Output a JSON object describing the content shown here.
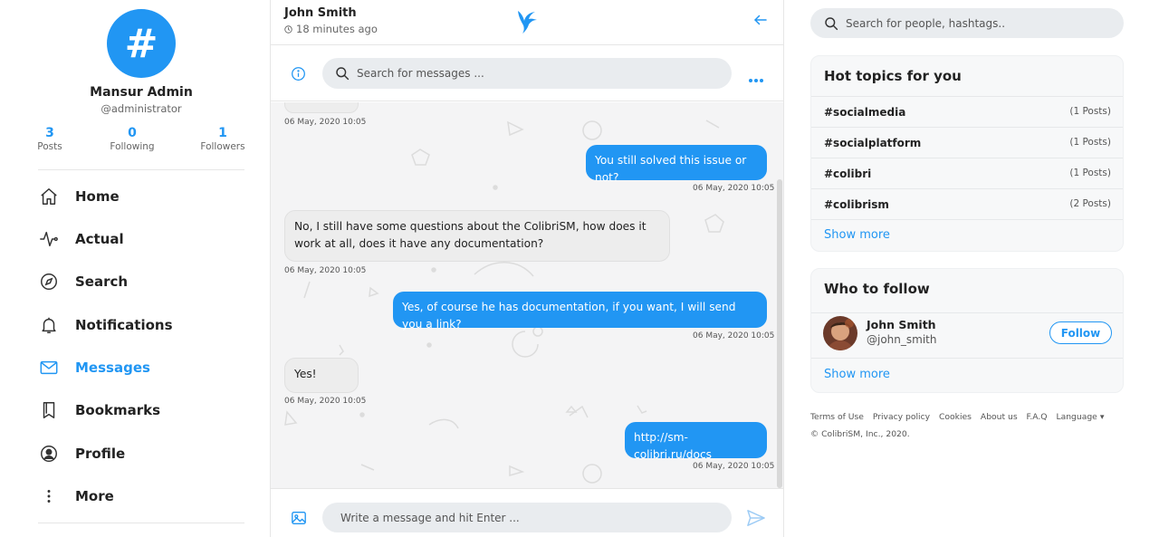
{
  "profile": {
    "avatar_glyph": "#",
    "name": "Mansur Admin",
    "handle": "@administrator",
    "stats": [
      {
        "value": "3",
        "label": "Posts"
      },
      {
        "value": "0",
        "label": "Following"
      },
      {
        "value": "1",
        "label": "Followers"
      }
    ]
  },
  "nav": [
    {
      "label": "Home",
      "icon": "home-icon",
      "active": false
    },
    {
      "label": "Actual",
      "icon": "pulse-icon",
      "active": false
    },
    {
      "label": "Search",
      "icon": "compass-icon",
      "active": false
    },
    {
      "label": "Notifications",
      "icon": "bell-icon",
      "active": false
    },
    {
      "label": "Messages",
      "icon": "mail-icon",
      "active": true
    },
    {
      "label": "Bookmarks",
      "icon": "bookmark-icon",
      "active": false
    },
    {
      "label": "Profile",
      "icon": "user-circle-icon",
      "active": false
    },
    {
      "label": "More",
      "icon": "more-vertical-icon",
      "active": false
    }
  ],
  "chat": {
    "contact_name": "John Smith",
    "last_seen": "18 minutes ago",
    "search_placeholder": "Search for messages ...",
    "compose_placeholder": "Write a message and hit Enter ...",
    "messages": [
      {
        "side": "in",
        "text": "",
        "time": "06 May, 2020 10:05"
      },
      {
        "side": "out",
        "text": "You still solved this issue or not?",
        "time": "06 May, 2020 10:05"
      },
      {
        "side": "in",
        "text": "No, I still have some questions about the ColibriSM, how does it work at all, does it have any documentation?",
        "time": "06 May, 2020 10:05"
      },
      {
        "side": "out",
        "text": "Yes, of course he has documentation, if you want, I will send you a link?",
        "time": "06 May, 2020 10:05"
      },
      {
        "side": "in",
        "text": "Yes!",
        "time": "06 May, 2020 10:05"
      },
      {
        "side": "out",
        "text": "http://sm-colibri.ru/docs",
        "time": "06 May, 2020 10:05"
      }
    ]
  },
  "right": {
    "search_placeholder": "Search for people, hashtags..",
    "hot_topics": {
      "title": "Hot topics for you",
      "items": [
        {
          "tag": "#socialmedia",
          "count": "(1 Posts)"
        },
        {
          "tag": "#socialplatform",
          "count": "(1 Posts)"
        },
        {
          "tag": "#colibri",
          "count": "(1 Posts)"
        },
        {
          "tag": "#colibrism",
          "count": "(2 Posts)"
        }
      ],
      "show_more": "Show more"
    },
    "who_to_follow": {
      "title": "Who to follow",
      "user": {
        "name": "John Smith",
        "handle": "@john_smith"
      },
      "follow_label": "Follow",
      "show_more": "Show more"
    },
    "footer_links": [
      "Terms of Use",
      "Privacy policy",
      "Cookies",
      "About us",
      "F.A.Q",
      "Language"
    ],
    "copyright": "© ColibriSM, Inc., 2020."
  },
  "colors": {
    "accent": "#2196f3",
    "bubble_in": "#ededed",
    "chat_bg": "#f4f4f5"
  }
}
